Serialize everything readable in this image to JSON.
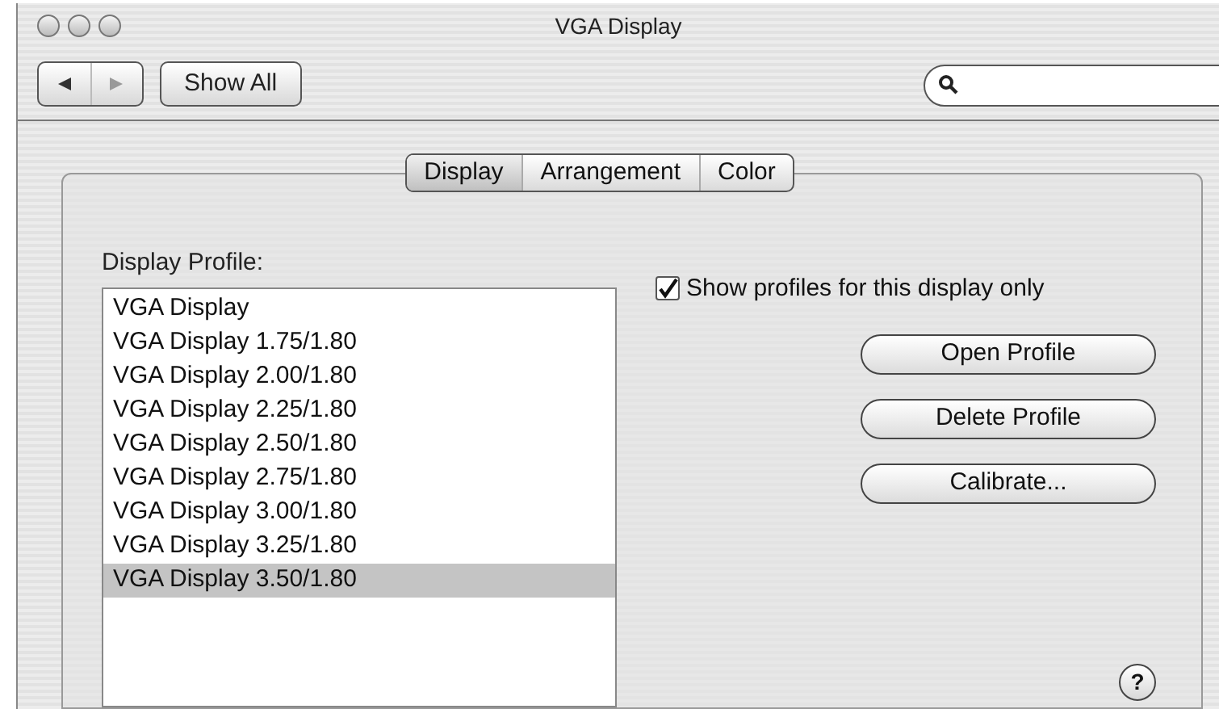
{
  "window": {
    "title": "VGA Display"
  },
  "toolbar": {
    "show_all": "Show All"
  },
  "tabs": [
    {
      "label": "Display",
      "selected": true
    },
    {
      "label": "Arrangement",
      "selected": false
    },
    {
      "label": "Color",
      "selected": false
    }
  ],
  "profile_list": {
    "label": "Display Profile:",
    "items": [
      {
        "label": "VGA Display",
        "selected": false
      },
      {
        "label": "VGA Display 1.75/1.80",
        "selected": false
      },
      {
        "label": "VGA Display 2.00/1.80",
        "selected": false
      },
      {
        "label": "VGA Display 2.25/1.80",
        "selected": false
      },
      {
        "label": "VGA Display 2.50/1.80",
        "selected": false
      },
      {
        "label": "VGA Display 2.75/1.80",
        "selected": false
      },
      {
        "label": "VGA Display 3.00/1.80",
        "selected": false
      },
      {
        "label": "VGA Display 3.25/1.80",
        "selected": false
      },
      {
        "label": "VGA Display 3.50/1.80",
        "selected": true
      }
    ]
  },
  "show_only_this_display": {
    "label": "Show profiles for this display only",
    "checked": true
  },
  "buttons": [
    "Open Profile",
    "Delete Profile",
    "Calibrate..."
  ],
  "help": "?"
}
